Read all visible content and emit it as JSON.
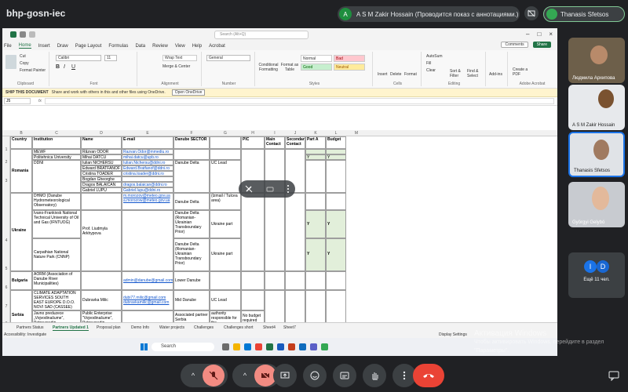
{
  "meeting": {
    "code": "bhp-gosn-iec",
    "presenter_initial": "A",
    "presenter_label": "A S M Zakir Hossain (Проводится показ с аннотациями.)",
    "you_label": "Thanasis Sfetsos"
  },
  "excel": {
    "title_search": "Search (Alt+Q)",
    "menu": [
      "File",
      "Home",
      "Insert",
      "Draw",
      "Page Layout",
      "Formulas",
      "Data",
      "Review",
      "View",
      "Help",
      "Acrobat"
    ],
    "active_menu": "Home",
    "comments_label": "Comments",
    "share_label": "Share",
    "ribbon": {
      "cut": "Cut",
      "copy": "Copy",
      "format_painter": "Format Painter",
      "clipboard": "Clipboard",
      "font_name": "Calibri",
      "font_size": "11",
      "font_group": "Font",
      "wrap_text": "Wrap Text",
      "merge_center": "Merge & Center",
      "alignment": "Alignment",
      "number_format": "General",
      "number": "Number",
      "cond_format": "Conditional Formatting",
      "format_table": "Format as Table",
      "style_normal": "Normal",
      "style_bad": "Bad",
      "style_good": "Good",
      "style_neutral": "Neutral",
      "styles": "Styles",
      "insert": "Insert",
      "delete": "Delete",
      "format": "Format",
      "cells": "Cells",
      "autosum": "AutoSum",
      "fill": "Fill",
      "clear": "Clear",
      "sort_filter": "Sort & Filter",
      "find_select": "Find & Select",
      "editing": "Editing",
      "addins": "Add-ins",
      "create_pdf": "Create a PDF",
      "adobe": "Adobe Acrobat"
    },
    "notice_bold": "SHIP THIS DOCUMENT",
    "notice_text": "Share and work with others in this and other files using OneDrive.",
    "notice_button": "Open OneDrive",
    "name_box": "J5",
    "fx": "fx",
    "col_letters": [
      "B",
      "C",
      "D",
      "E",
      "F",
      "G",
      "H",
      "I",
      "J",
      "K",
      "L",
      "M"
    ],
    "row_numbers": [
      "1",
      "2",
      "",
      "3",
      "",
      "",
      "",
      "",
      "4",
      "",
      "5",
      "",
      "6",
      "",
      "7",
      "",
      "8",
      ""
    ],
    "headers": {
      "country": "Country",
      "institution": "Institution",
      "name": "Name",
      "email": "E-mail",
      "sector": "Danube SECTOR",
      "pic": "PIC",
      "main_contact": "Main Contact",
      "secondary_contact": "Secondary Contact",
      "part_a": "Part A",
      "budget": "Budget"
    },
    "cells": {
      "romania": "Romania",
      "mewf": "MEWF",
      "polytech": "Politehnica University",
      "ddni": "DDNI",
      "n1": "Răzvan ODOR",
      "n2": "Mihai DATCU",
      "n3": "Iulian NICHERSU",
      "n4": "Edward BRATFANOF",
      "n5": "Cristina TOADER",
      "n6": "Bogdan Gheorghe",
      "n7": "Dragos BALAICAN",
      "n8": "Gabriel LUPU",
      "e1": "Razvan.Odor@mmediu.ro",
      "e2": "mihai.datcu@upb.ro",
      "e3": "Iulian.Nichersu@ddni.ro",
      "e4": "Edward.Bratfanof@ddni.ro",
      "e5": "cristina.toader@ddni.ro",
      "e7": "dragos.balaican@ddni.ro",
      "e8": "Gabriel.lupu@ddni.ro",
      "s3": "Danube Delta",
      "h3": "UC Lead",
      "y": "Y",
      "ukraine": "Ukraine",
      "dhmo": "DHMO (Danube Hydrometeorological Observatory)",
      "ifntu": "Ivano-Frankivsk National Technical University of Oil and Gas (IFNTUOG)",
      "cnnp": "Carpathian National Nature Park (CNNP)",
      "ludmila": "Prof. Liudmyla Arkhypova",
      "eu1": "m.morozov@meteo.gov.ua",
      "eu2": "a.morozow@meteo.gov.ua",
      "su1": "Danube Delta",
      "su2": "Danube Delta (Romanian-Ukrainian Transboundary Prior)",
      "su3": "Danube Delta (Romanian-Ukrainian Transboundary Prior)",
      "hu1": "(Izmail / Tulcea area)",
      "hu2": "Ukraine part",
      "hu3": "Ukraine part",
      "bulgaria": "Bulgaria",
      "adorm": "AORM (Association of Danube River Municipalities)",
      "eb": "admin@danube@gmail.com",
      "sb": "Lower Danube",
      "serbia": "Serbia",
      "cassed": "CLIMATE ADAPTATION SERVICES SOUTH EAST EUROPE D.O.O. NOVI SAD (CASSEE)",
      "nd": "Dubravka Milic",
      "ed1": "dubi77.milic@gmail.com",
      "ed2": "dubravkamilic@gmail.com",
      "sd": "Mid Danube",
      "hd": "UC Lead",
      "jp": "Javno preduzece „Vojvodinašume“, Petrovaradin",
      "pe": "Public Enterprise “Vojvodinašume”, Petrovaradin",
      "sp": "Associated partner Serbia",
      "hp": "authority responsible for the management of the protected area (Prednia ...",
      "ip": "No budget required"
    },
    "sheets": [
      "Partners Status",
      "Partners Updated 1",
      "Proposal plan",
      "Demo Info",
      "Water projects",
      "Challenges",
      "Challenges short",
      "Sheet4",
      "Sheet7"
    ],
    "active_sheet": "Partners Updated 1",
    "status_left": "Accessibility: Investigate",
    "status_right": "Display Settings",
    "taskbar_search": "Search"
  },
  "overlay_activate": {
    "line1": "Активация Windows",
    "line2": "Чтобы активировать Windows, перейдите в раздел \"Параметры\"."
  },
  "participants": [
    {
      "name": "Людмила Архипова"
    },
    {
      "name": "A S M Zakir Hossain"
    },
    {
      "name": "Thanasis Sfetsos"
    },
    {
      "name": "Györgyi Gelybó"
    }
  ],
  "more": {
    "bubble1": "I",
    "bubble2": "D",
    "count_label": "Ещё 11 чел."
  },
  "colors": {
    "accent_excel": "#217346",
    "meet_bg": "#202124",
    "end_call": "#ea4335",
    "muted": "#f28b82"
  }
}
